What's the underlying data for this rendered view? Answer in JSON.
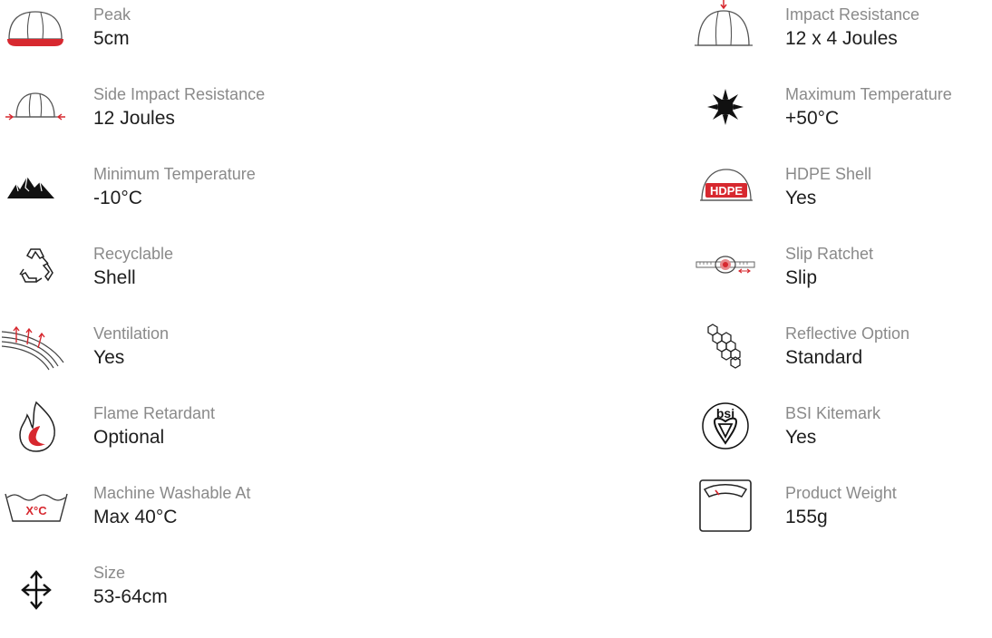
{
  "colors": {
    "accent": "#d7282f",
    "icon": "#111111",
    "label": "#8a8a8a",
    "value": "#1e1e1e"
  },
  "left": [
    {
      "icon": "helmet-peak-icon",
      "label": "Peak",
      "value": "5cm"
    },
    {
      "icon": "side-impact-icon",
      "label": "Side Impact Resistance",
      "value": "12 Joules"
    },
    {
      "icon": "mountains-icon",
      "label": "Minimum Temperature",
      "value": "-10°C"
    },
    {
      "icon": "recycle-icon",
      "label": "Recyclable",
      "value": "Shell"
    },
    {
      "icon": "ventilation-icon",
      "label": "Ventilation",
      "value": "Yes"
    },
    {
      "icon": "flame-icon",
      "label": "Flame Retardant",
      "value": "Optional"
    },
    {
      "icon": "wash-icon",
      "label": "Machine Washable At",
      "value": "Max 40°C",
      "icon_text": "X°C"
    },
    {
      "icon": "size-arrows-icon",
      "label": "Size",
      "value": "53-64cm"
    }
  ],
  "right": [
    {
      "icon": "top-impact-icon",
      "label": "Impact Resistance",
      "value": "12 x 4 Joules"
    },
    {
      "icon": "sun-icon",
      "label": "Maximum Temperature",
      "value": "+50°C"
    },
    {
      "icon": "hdpe-shell-icon",
      "label": "HDPE Shell",
      "value": "Yes",
      "icon_text": "HDPE"
    },
    {
      "icon": "ratchet-icon",
      "label": "Slip Ratchet",
      "value": "Slip"
    },
    {
      "icon": "honeycomb-icon",
      "label": "Reflective Option",
      "value": "Standard"
    },
    {
      "icon": "kitemark-icon",
      "label": "BSI Kitemark",
      "value": "Yes",
      "icon_text": "bsi"
    },
    {
      "icon": "weight-scale-icon",
      "label": "Product Weight",
      "value": "155g"
    }
  ]
}
